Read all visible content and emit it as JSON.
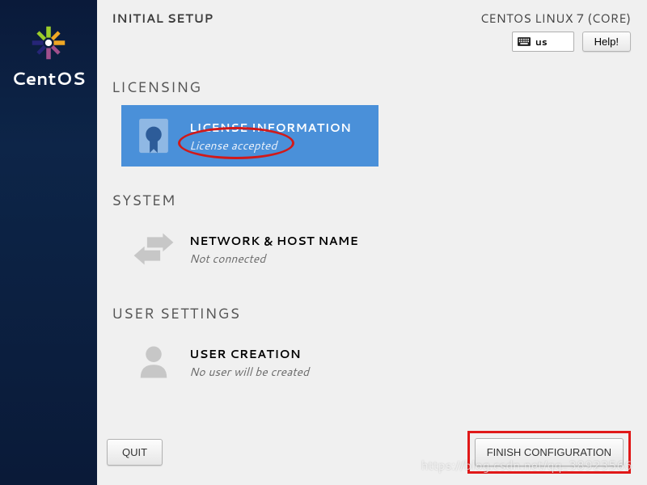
{
  "branding": {
    "product": "CentOS"
  },
  "header": {
    "title": "INITIAL SETUP",
    "distro": "CENTOS LINUX 7 (CORE)",
    "keyboard_layout": "us",
    "help_label": "Help!"
  },
  "sections": {
    "licensing": {
      "heading": "LICENSING",
      "spoke": {
        "title": "LICENSE INFORMATION",
        "status": "License accepted"
      }
    },
    "system": {
      "heading": "SYSTEM",
      "spoke": {
        "title": "NETWORK & HOST NAME",
        "status": "Not connected"
      }
    },
    "user": {
      "heading": "USER SETTINGS",
      "spoke": {
        "title": "USER CREATION",
        "status": "No user will be created"
      }
    }
  },
  "footer": {
    "quit_label": "QUIT",
    "finish_label": "FINISH CONFIGURATION"
  },
  "watermark": "https://blog.csdn.net/qq_38923566"
}
